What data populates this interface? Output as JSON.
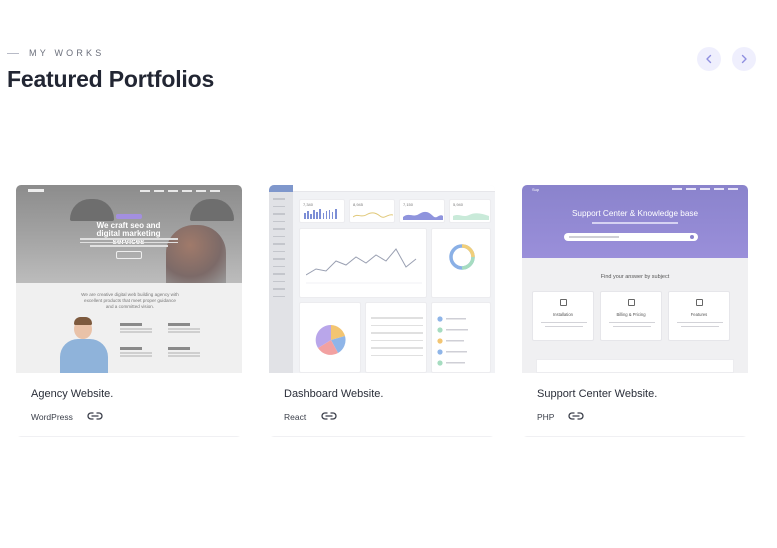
{
  "header": {
    "eyebrow": "MY WORKS",
    "title": "Featured Portfolios"
  },
  "nav": {
    "prev_icon": "chevron-left-icon",
    "next_icon": "chevron-right-icon",
    "button_bg": "#efeffd",
    "icon_color": "#8f8fe0"
  },
  "portfolios": [
    {
      "name": "Agency Website.",
      "tech": "WordPress",
      "link_icon": "link-icon",
      "thumb": {
        "headline": "We craft seo and digital marketing services",
        "body_title": "We are creative digital web building agency with excellent products that meet proper guidance and a committed vision."
      }
    },
    {
      "name": "Dashboard Website.",
      "tech": "React",
      "link_icon": "link-icon",
      "thumb": {
        "stats": [
          "7,340",
          "8,945",
          "7,150",
          "5,940"
        ]
      }
    },
    {
      "name": "Support Center Website.",
      "tech": "PHP",
      "link_icon": "link-icon",
      "thumb": {
        "logo": "Sup",
        "title": "Support Center & Knowledge base",
        "subheading": "Find your answer by subject",
        "tiles": [
          "Installation",
          "Billing & Pricing",
          "Features"
        ]
      }
    }
  ]
}
